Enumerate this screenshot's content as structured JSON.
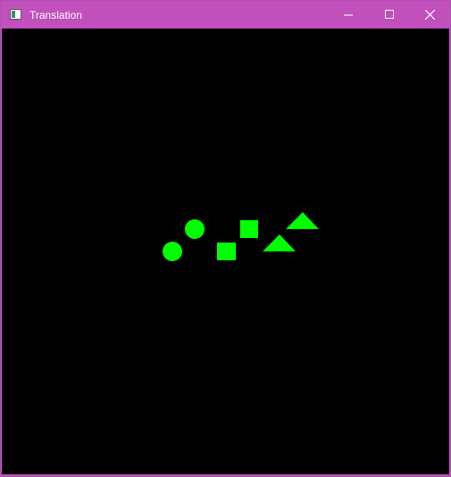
{
  "window": {
    "title": "Translation",
    "titlebar_color": "#c150bd",
    "canvas_background": "#000000",
    "controls": {
      "minimize_icon": "minimize-icon",
      "maximize_icon": "maximize-icon",
      "close_icon": "close-icon"
    }
  },
  "scene": {
    "shape_color": "#00ff00",
    "shapes": [
      "circle",
      "circle",
      "square",
      "square",
      "triangle",
      "triangle"
    ]
  }
}
